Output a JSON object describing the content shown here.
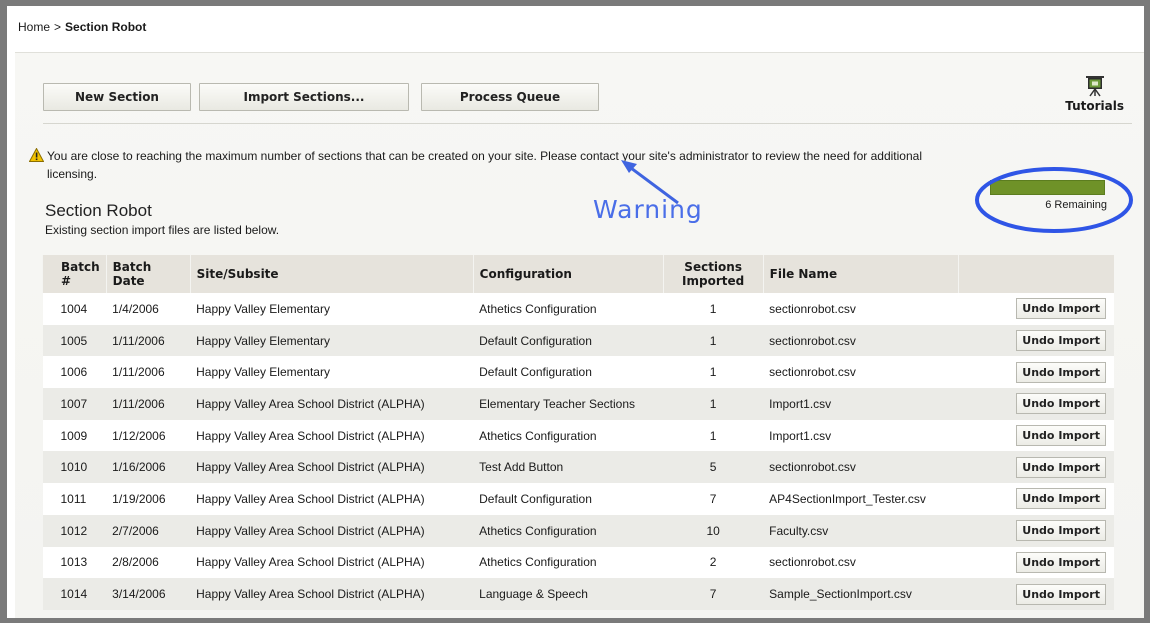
{
  "breadcrumb": {
    "home": "Home",
    "separator": ">",
    "current": "Section Robot"
  },
  "toolbar": {
    "new_section": "New Section",
    "import_sections": "Import Sections...",
    "process_queue": "Process Queue"
  },
  "tutorials": {
    "label": "Tutorials",
    "icon": "easel-icon"
  },
  "warning": {
    "line1": "You are close to reaching the maximum number of sections that can be created on your site. Please contact your site's administrator to review the need for additional",
    "line2": "licensing.",
    "annotation": "Warning"
  },
  "meter": {
    "fill_fraction": 1.0,
    "label": "6 Remaining",
    "color": "#6f9228"
  },
  "page": {
    "title": "Section Robot",
    "subtitle": "Existing section import files are listed below."
  },
  "table": {
    "headers": {
      "batch": "Batch #",
      "date": "Batch Date",
      "site": "Site/Subsite",
      "config": "Configuration",
      "imported": "Sections Imported",
      "file": "File Name"
    },
    "action_label": "Undo Import",
    "rows": [
      {
        "batch": "1004",
        "date": "1/4/2006",
        "site": "Happy Valley Elementary",
        "config": "Athetics Configuration",
        "imported": "1",
        "file": "sectionrobot.csv"
      },
      {
        "batch": "1005",
        "date": "1/11/2006",
        "site": "Happy Valley Elementary",
        "config": "Default Configuration",
        "imported": "1",
        "file": "sectionrobot.csv"
      },
      {
        "batch": "1006",
        "date": "1/11/2006",
        "site": "Happy Valley Elementary",
        "config": "Default Configuration",
        "imported": "1",
        "file": "sectionrobot.csv"
      },
      {
        "batch": "1007",
        "date": "1/11/2006",
        "site": "Happy Valley Area School District (ALPHA)",
        "config": "Elementary Teacher Sections",
        "imported": "1",
        "file": "Import1.csv"
      },
      {
        "batch": "1009",
        "date": "1/12/2006",
        "site": "Happy Valley Area School District (ALPHA)",
        "config": "Athetics Configuration",
        "imported": "1",
        "file": "Import1.csv"
      },
      {
        "batch": "1010",
        "date": "1/16/2006",
        "site": "Happy Valley Area School District (ALPHA)",
        "config": "Test Add Button",
        "imported": "5",
        "file": "sectionrobot.csv"
      },
      {
        "batch": "1011",
        "date": "1/19/2006",
        "site": "Happy Valley Area School District (ALPHA)",
        "config": "Default Configuration",
        "imported": "7",
        "file": "AP4SectionImport_Tester.csv"
      },
      {
        "batch": "1012",
        "date": "2/7/2006",
        "site": "Happy Valley Area School District (ALPHA)",
        "config": "Athetics Configuration",
        "imported": "10",
        "file": "Faculty.csv"
      },
      {
        "batch": "1013",
        "date": "2/8/2006",
        "site": "Happy Valley Area School District (ALPHA)",
        "config": "Athetics Configuration",
        "imported": "2",
        "file": "sectionrobot.csv"
      },
      {
        "batch": "1014",
        "date": "3/14/2006",
        "site": "Happy Valley Area School District (ALPHA)",
        "config": "Language & Speech",
        "imported": "7",
        "file": "Sample_SectionImport.csv"
      }
    ]
  },
  "colors": {
    "annotation": "#4a6ee8",
    "meter": "#6f9228",
    "warning_icon": "#f2c200"
  }
}
